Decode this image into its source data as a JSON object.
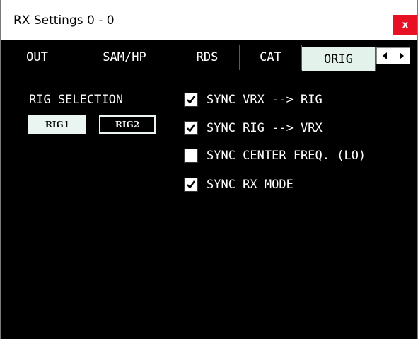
{
  "window": {
    "title": "RX Settings 0 - 0",
    "close_label": "x"
  },
  "tabs": [
    {
      "label": "OUT",
      "active": false
    },
    {
      "label": "SAM/HP",
      "active": false
    },
    {
      "label": "RDS",
      "active": false
    },
    {
      "label": "CAT",
      "active": false
    },
    {
      "label": "ORIG",
      "active": true
    }
  ],
  "tab_scroll": {
    "left_icon": "arrow-left-icon",
    "right_icon": "arrow-right-icon"
  },
  "rig_selection": {
    "label": "RIG SELECTION",
    "options": [
      {
        "label": "RIG1",
        "selected": true
      },
      {
        "label": "RIG2",
        "selected": false
      }
    ]
  },
  "sync_options": [
    {
      "label": "SYNC VRX --> RIG",
      "checked": true
    },
    {
      "label": "SYNC RIG --> VRX",
      "checked": true
    },
    {
      "label": "SYNC CENTER FREQ. (LO)",
      "checked": false
    },
    {
      "label": "SYNC RX MODE",
      "checked": true
    }
  ],
  "colors": {
    "background": "#000000",
    "text": "#ffffff",
    "active_tab": "#e3f3eb",
    "close_button": "#e81123"
  }
}
